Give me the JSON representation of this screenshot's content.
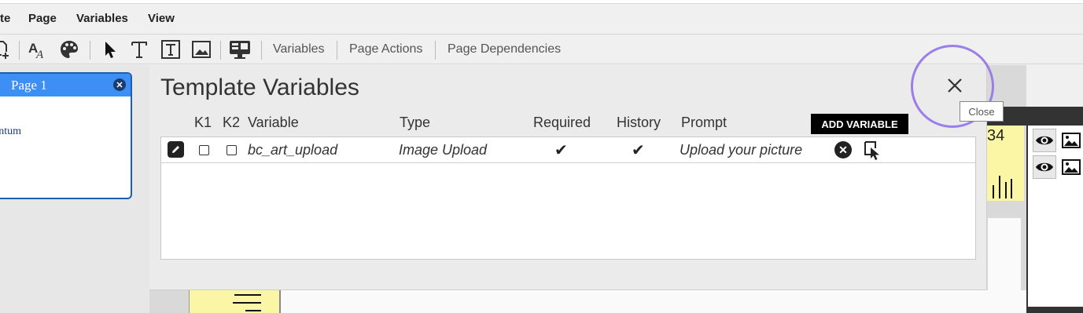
{
  "menu": {
    "items": [
      {
        "label": "te"
      },
      {
        "label": "Page"
      },
      {
        "label": "Variables"
      },
      {
        "label": "View"
      }
    ]
  },
  "toolbar": {
    "icons": [
      "add-page-icon",
      "font-style-icon",
      "palette-icon",
      "pointer-icon",
      "text-tool-icon",
      "text-box-icon",
      "image-tool-icon",
      "preview-monitor-icon"
    ],
    "variables_label": "Variables",
    "page_actions_label": "Page Actions",
    "page_dependencies_label": "Page Dependencies"
  },
  "pages_panel": {
    "page_label": "Page 1",
    "thumb_text": "antum"
  },
  "modal": {
    "title": "Template Variables",
    "columns": [
      "K1",
      "K2",
      "Variable",
      "Type",
      "Required",
      "History",
      "Prompt"
    ],
    "add_button_label": "ADD VARIABLE",
    "rows": [
      {
        "k1": false,
        "k2": false,
        "variable": "bc_art_upload",
        "type": "Image Upload",
        "required": true,
        "history": true,
        "prompt": "Upload your picture"
      }
    ],
    "check_glyph": "✔"
  },
  "close": {
    "tooltip": "Close"
  },
  "canvas": {
    "right_number": "34"
  },
  "colors": {
    "page_header_blue": "#3d8ff5",
    "highlight_ring": "#9b7ee8",
    "guide_yellow": "#fbf6a6"
  }
}
